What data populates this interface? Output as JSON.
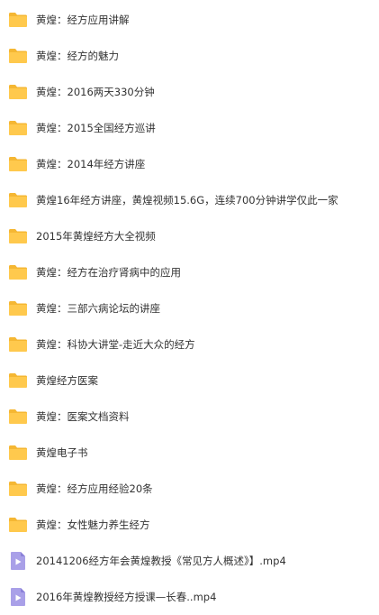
{
  "colors": {
    "folder": "#FFC94D",
    "folder_tab": "#F5B733",
    "video_body": "#A9A0E8",
    "video_fold": "#8A80D8",
    "video_play": "#ffffff",
    "text": "#333333"
  },
  "items": [
    {
      "type": "folder",
      "icon": "folder-icon",
      "name": "黄煌：经方应用讲解"
    },
    {
      "type": "folder",
      "icon": "folder-icon",
      "name": "黄煌：经方的魅力"
    },
    {
      "type": "folder",
      "icon": "folder-icon",
      "name": "黄煌：2016两天330分钟"
    },
    {
      "type": "folder",
      "icon": "folder-icon",
      "name": "黄煌：2015全国经方巡讲"
    },
    {
      "type": "folder",
      "icon": "folder-icon",
      "name": "黄煌：2014年经方讲座"
    },
    {
      "type": "folder",
      "icon": "folder-icon",
      "name": "黄煌16年经方讲座，黄煌视频15.6G，连续700分钟讲学仅此一家"
    },
    {
      "type": "folder",
      "icon": "folder-icon",
      "name": "2015年黄煌经方大全视频"
    },
    {
      "type": "folder",
      "icon": "folder-icon",
      "name": "黄煌：经方在治疗肾病中的应用"
    },
    {
      "type": "folder",
      "icon": "folder-icon",
      "name": "黄煌：三部六病论坛的讲座"
    },
    {
      "type": "folder",
      "icon": "folder-icon",
      "name": "黄煌：科协大讲堂-走近大众的经方"
    },
    {
      "type": "folder",
      "icon": "folder-icon",
      "name": "黄煌经方医案"
    },
    {
      "type": "folder",
      "icon": "folder-icon",
      "name": "黄煌：医案文档资料"
    },
    {
      "type": "folder",
      "icon": "folder-icon",
      "name": "黄煌电子书"
    },
    {
      "type": "folder",
      "icon": "folder-icon",
      "name": "黄煌：经方应用经验20条"
    },
    {
      "type": "folder",
      "icon": "folder-icon",
      "name": "黄煌：女性魅力养生经方"
    },
    {
      "type": "video",
      "icon": "video-file-icon",
      "name": "20141206经方年会黄煌教授《常见方人概述》】.mp4"
    },
    {
      "type": "video",
      "icon": "video-file-icon",
      "name": "2016年黄煌教授经方授课—长春..mp4"
    }
  ]
}
